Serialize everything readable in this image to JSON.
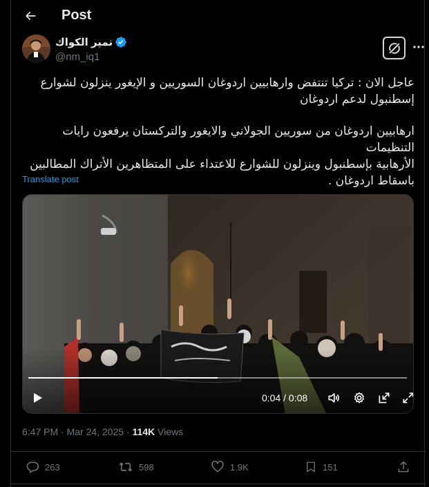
{
  "header": {
    "title": "Post",
    "back_icon": "arrow-left-icon"
  },
  "author": {
    "name": "نمير الكواك",
    "handle": "@nm_iq1",
    "verified_color": "#1d9bf0"
  },
  "post": {
    "paragraphs": [
      {
        "lines": [
          "عاجل الان : تركيا تنتفض وارهابيين اردوغان السوريين و الإيغور ينزلون لشوارع",
          "إسطنبول لدعم اردوغان"
        ]
      },
      {
        "lines": [
          "ارهابيين اردوغان من سوريين الجولاني  والايغور والتركستان يرفعون رايات التنظيمات",
          "الأرهابية بإسطنبول وينزلون للشوارع للاعتداء على المتظاهرين الأتراك المطالبين",
          "باسقاط اردوغان ."
        ]
      }
    ],
    "translate_label": "Translate post"
  },
  "video": {
    "current_time": "0:04",
    "duration": "0:08",
    "time_separator": " / ",
    "progress_fraction": 0.5
  },
  "meta": {
    "time": "6:47 PM",
    "date": "Mar 24, 2025",
    "separator": " · ",
    "views_count": "114K",
    "views_label": " Views"
  },
  "actions": {
    "replies": "263",
    "reposts": "598",
    "likes": "1.9K",
    "bookmarks": "151"
  },
  "colors": {
    "accent": "#1d9bf0",
    "text": "#e7e9ea",
    "muted": "#71767b",
    "border": "#2f3336"
  }
}
